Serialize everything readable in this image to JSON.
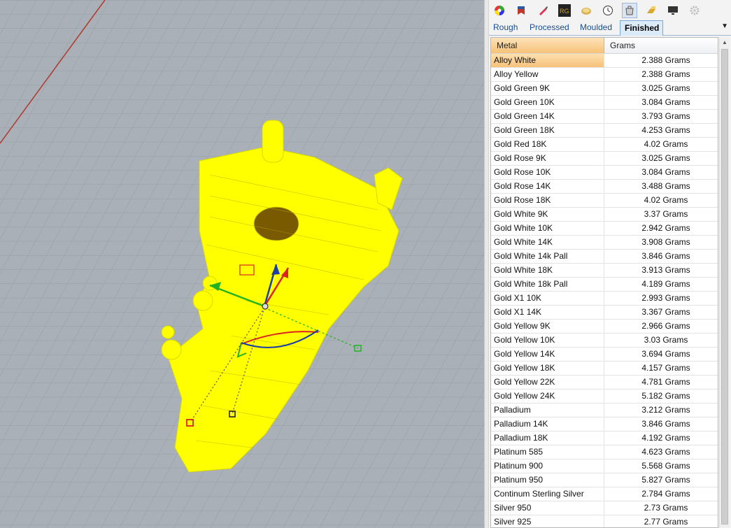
{
  "toolbar": {
    "icons": [
      "color-wheel-icon",
      "bookmark-icon",
      "brush-icon",
      "rg-icon",
      "gem-icon",
      "clock-icon",
      "weight-icon",
      "gold-icon",
      "monitor-icon",
      "gear-icon"
    ],
    "rg_label": "RG"
  },
  "tabs": [
    {
      "label": "Rough"
    },
    {
      "label": "Processed"
    },
    {
      "label": "Moulded"
    },
    {
      "label": "Finished"
    }
  ],
  "table": {
    "headers": {
      "metal": "Metal",
      "grams": "Grams"
    },
    "rows": [
      {
        "metal": "Alloy White",
        "grams": "2.388 Grams"
      },
      {
        "metal": "Alloy Yellow",
        "grams": "2.388 Grams"
      },
      {
        "metal": "Gold Green 9K",
        "grams": "3.025 Grams"
      },
      {
        "metal": "Gold Green 10K",
        "grams": "3.084 Grams"
      },
      {
        "metal": "Gold Green 14K",
        "grams": "3.793 Grams"
      },
      {
        "metal": "Gold Green 18K",
        "grams": "4.253 Grams"
      },
      {
        "metal": "Gold Red 18K",
        "grams": "4.02 Grams"
      },
      {
        "metal": "Gold Rose 9K",
        "grams": "3.025 Grams"
      },
      {
        "metal": "Gold Rose 10K",
        "grams": "3.084 Grams"
      },
      {
        "metal": "Gold Rose 14K",
        "grams": "3.488 Grams"
      },
      {
        "metal": "Gold Rose 18K",
        "grams": "4.02 Grams"
      },
      {
        "metal": "Gold White 9K",
        "grams": "3.37 Grams"
      },
      {
        "metal": "Gold White 10K",
        "grams": "2.942 Grams"
      },
      {
        "metal": "Gold White 14K",
        "grams": "3.908 Grams"
      },
      {
        "metal": "Gold White 14k Pall",
        "grams": "3.846 Grams"
      },
      {
        "metal": "Gold White 18K",
        "grams": "3.913 Grams"
      },
      {
        "metal": "Gold White 18k Pall",
        "grams": "4.189 Grams"
      },
      {
        "metal": "Gold X1 10K",
        "grams": "2.993 Grams"
      },
      {
        "metal": "Gold X1 14K",
        "grams": "3.367 Grams"
      },
      {
        "metal": "Gold Yellow 9K",
        "grams": "2.966 Grams"
      },
      {
        "metal": "Gold Yellow 10K",
        "grams": "3.03 Grams"
      },
      {
        "metal": "Gold Yellow 14K",
        "grams": "3.694 Grams"
      },
      {
        "metal": "Gold Yellow 18K",
        "grams": "4.157 Grams"
      },
      {
        "metal": "Gold Yellow 22K",
        "grams": "4.781 Grams"
      },
      {
        "metal": "Gold Yellow 24K",
        "grams": "5.182 Grams"
      },
      {
        "metal": "Palladium",
        "grams": "3.212 Grams"
      },
      {
        "metal": "Palladium 14K",
        "grams": "3.846 Grams"
      },
      {
        "metal": "Palladium 18K",
        "grams": "4.192 Grams"
      },
      {
        "metal": "Platinum 585",
        "grams": "4.623 Grams"
      },
      {
        "metal": "Platinum 900",
        "grams": "5.568 Grams"
      },
      {
        "metal": "Platinum 950",
        "grams": "5.827 Grams"
      },
      {
        "metal": "Continum Sterling Silver",
        "grams": "2.784 Grams"
      },
      {
        "metal": "Silver 950",
        "grams": "2.73 Grams"
      },
      {
        "metal": "Silver 925",
        "grams": "2.77 Grams"
      }
    ]
  },
  "colors": {
    "viewport_bg": "#a9b0b7",
    "model": "#ffff00",
    "selection": "#f7c27a",
    "x_axis": "#c0392b"
  }
}
